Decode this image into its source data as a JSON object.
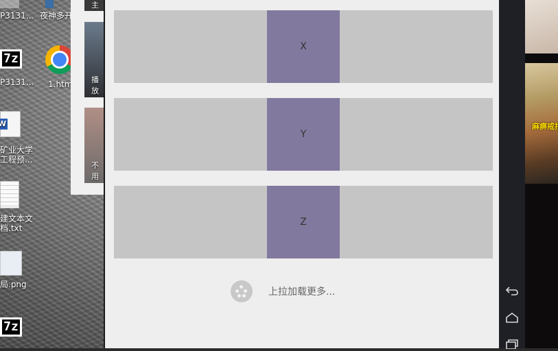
{
  "desktop": {
    "icons": [
      {
        "label": "P3131..."
      },
      {
        "label": "夜神多开"
      },
      {
        "label": "P3131..."
      },
      {
        "label": "1.htm"
      },
      {
        "label": "矿业大学"
      },
      {
        "label": "工程预..."
      },
      {
        "label": "建文本文"
      },
      {
        "label": "档.txt"
      },
      {
        "label": "局.png"
      }
    ],
    "seven_zip_text": "7z",
    "doc_badge": "W"
  },
  "background_window": {
    "thumbs": [
      {
        "label": "她主"
      },
      {
        "label": "播放"
      },
      {
        "label": "不用"
      }
    ]
  },
  "app": {
    "cards": [
      {
        "label": "X"
      },
      {
        "label": "Y"
      },
      {
        "label": "Z"
      }
    ],
    "load_more_label": "上拉加载更多..."
  },
  "navbar": {
    "buttons": [
      {
        "icon": "back-icon"
      },
      {
        "icon": "home-icon"
      },
      {
        "icon": "recent-apps-icon"
      }
    ]
  },
  "right_strip": {
    "game_caption": "麻痹戒指"
  }
}
